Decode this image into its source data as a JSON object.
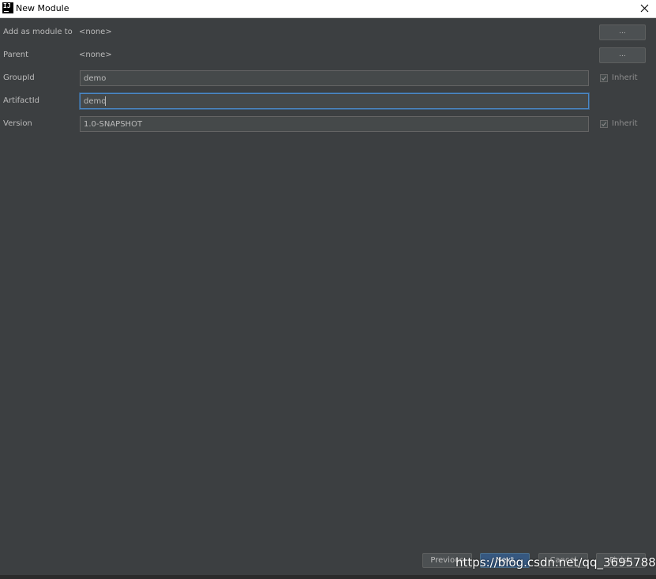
{
  "window": {
    "title": "New Module",
    "app_icon_text": "IJ"
  },
  "form": {
    "add_as_module_to": {
      "label": "Add as module to",
      "value": "<none>",
      "browse_label": "..."
    },
    "parent": {
      "label": "Parent",
      "value": "<none>",
      "browse_label": "..."
    },
    "group_id": {
      "label": "GroupId",
      "value": "demo",
      "inherit_label": "Inherit",
      "inherit_checked": true
    },
    "artifact_id": {
      "label": "ArtifactId",
      "value": "demo"
    },
    "version": {
      "label": "Version",
      "value": "1.0-SNAPSHOT",
      "inherit_label": "Inherit",
      "inherit_checked": true
    }
  },
  "footer": {
    "previous_label": "Previous",
    "next_label": "Next",
    "cancel_label": "Cancel",
    "finish_label": "Finish"
  },
  "watermark": "https://blog.csdn.net/qq_36957885",
  "colors": {
    "background": "#3c3f41",
    "focus_border": "#4a88c7",
    "default_button": "#365880"
  }
}
